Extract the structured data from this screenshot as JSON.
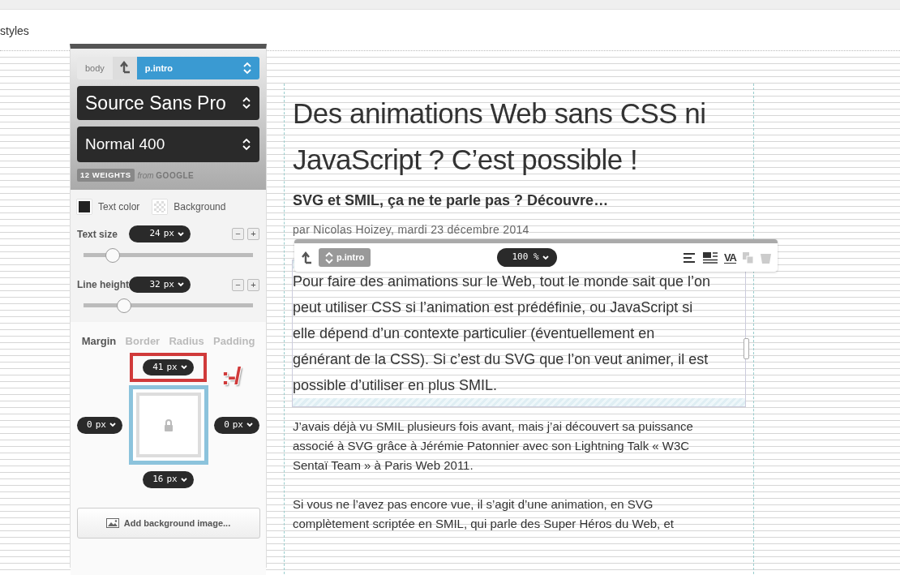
{
  "header": {
    "title": "styles"
  },
  "panel": {
    "breadcrumb": [
      {
        "kind": "element",
        "label": "body"
      },
      {
        "kind": "parent"
      },
      {
        "kind": "current",
        "label": "p.intro"
      }
    ],
    "font_family": "Source Sans Pro",
    "font_weight": "Normal 400",
    "weights_badge": "12 WEIGHTS",
    "source_prefix": "from",
    "source": "GOOGLE",
    "swatches": [
      {
        "kind": "solid",
        "label": "Text color"
      },
      {
        "kind": "transparent",
        "label": "Background"
      }
    ],
    "sliders": [
      {
        "label": "Text size",
        "value": "24",
        "unit": "px",
        "decrement": "−",
        "increment": "+",
        "level": 0.17
      },
      {
        "label": "Line height",
        "value": "32",
        "unit": "px",
        "decrement": "−",
        "increment": "+",
        "level": 0.24
      }
    ],
    "box_tabs": [
      {
        "label": "Margin",
        "selected": true
      },
      {
        "label": "Border",
        "selected": false
      },
      {
        "label": "Radius",
        "selected": false
      },
      {
        "label": "Padding",
        "selected": false
      }
    ],
    "box": {
      "top": {
        "value": "41",
        "unit": "px",
        "highlighted": true
      },
      "left": {
        "value": "0",
        "unit": "px",
        "highlighted": false
      },
      "right": {
        "value": "0",
        "unit": "px",
        "highlighted": false
      },
      "bottom": {
        "value": "16",
        "unit": "px",
        "highlighted": false
      }
    },
    "emoticon": ":-/",
    "add_background_button": "Add background image..."
  },
  "toolbar": {
    "selector": "p.intro",
    "zoom": "100 %",
    "tools": [
      {
        "kind": "align",
        "disabled": false
      },
      {
        "kind": "wrap",
        "disabled": false
      },
      {
        "kind": "tracking",
        "label": "VA",
        "disabled": false
      },
      {
        "kind": "duplicate",
        "disabled": true
      },
      {
        "kind": "delete",
        "disabled": true
      }
    ]
  },
  "article": {
    "title": "Des animations Web sans CSS ni JavaScript ? C’est possible !",
    "subtitle": "SVG et SMIL, ça ne te parle pas ? Découvre…",
    "byline": "par Nicolas Hoizey, mardi 23 décembre 2014",
    "intro": "Pour faire des animations sur le Web, tout le monde sait que l’on peut utiliser CSS si l’animation est prédéfinie, ou JavaScript si elle dépend d’un contexte particulier (éventuellement en générant de la CSS). Si c’est du SVG que l’on veut animer, il est possible d’utiliser en plus SMIL.",
    "paragraphs": [
      "J’avais déjà vu SMIL plusieurs fois avant, mais j’ai découvert sa puissance associé à SVG grâce à Jérémie Patonnier avec son Lightning Talk « W3C Sentaï Team » à Paris Web 2011.",
      "Si vous ne l’avez pas encore vue, il s’agit d’une animation, en SVG complètement scriptée en SMIL, qui parle des Super Héros du Web, et"
    ]
  }
}
